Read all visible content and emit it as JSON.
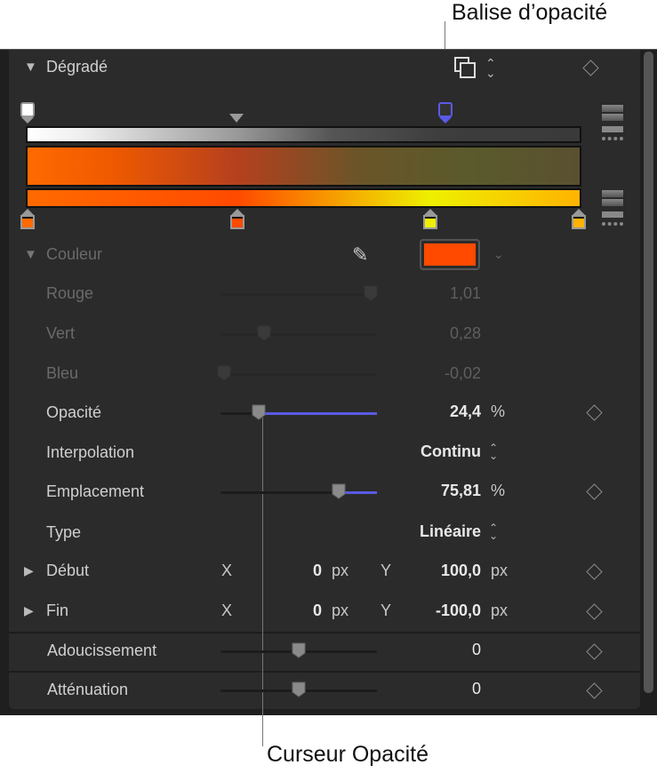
{
  "callouts": {
    "top": "Balise d’opacité",
    "bottom": "Curseur Opacité"
  },
  "gradient": {
    "title": "Dégradé",
    "opacity_stops": [
      {
        "position": 0,
        "color": "#ffffff"
      },
      {
        "position": 75.81,
        "color": "#333333",
        "selected": true
      }
    ],
    "opacity_midpoint": 38,
    "color_stops": [
      {
        "position": 0,
        "color": "#ff6a00"
      },
      {
        "position": 38,
        "color": "#ff4a00"
      },
      {
        "position": 73,
        "color": "#eef000"
      },
      {
        "position": 100,
        "color": "#ffb300"
      }
    ],
    "accent": "#5a5ae6"
  },
  "color": {
    "label": "Couleur",
    "swatch": "#ff4a00",
    "rows": [
      {
        "label": "Rouge",
        "value": "1,01",
        "level": 0.96
      },
      {
        "label": "Vert",
        "value": "0,28",
        "level": 0.28
      },
      {
        "label": "Bleu",
        "value": "-0,02",
        "level": 0.02
      }
    ]
  },
  "opacity": {
    "label": "Opacité",
    "value": "24,4",
    "unit": "%",
    "level": 0.244
  },
  "interpolation": {
    "label": "Interpolation",
    "value": "Continu"
  },
  "location": {
    "label": "Emplacement",
    "value": "75,81",
    "unit": "%",
    "level": 0.7581
  },
  "type": {
    "label": "Type",
    "value": "Linéaire"
  },
  "start": {
    "label": "Début",
    "x_label": "X",
    "x": "0",
    "x_unit": "px",
    "y_label": "Y",
    "y": "100,0",
    "y_unit": "px"
  },
  "end": {
    "label": "Fin",
    "x_label": "X",
    "x": "0",
    "x_unit": "px",
    "y_label": "Y",
    "y": "-100,0",
    "y_unit": "px"
  },
  "softness": {
    "label": "Adoucissement",
    "value": "0",
    "level": 0.5
  },
  "falloff": {
    "label": "Atténuation",
    "value": "0",
    "level": 0.5
  }
}
